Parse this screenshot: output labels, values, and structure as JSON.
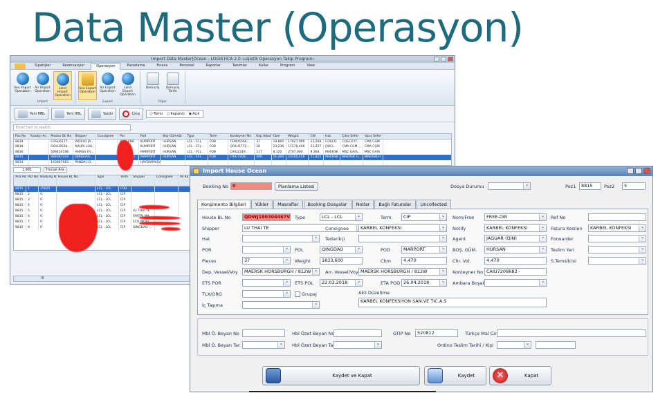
{
  "slide": {
    "title": "Data Master (Operasyon)"
  },
  "back_window": {
    "title": "Import Data Master|Ocean - LOGISTICA 2.0 -Lojistik Operasyon Takip Programı",
    "tabs": [
      "Siparişler",
      "Rezervasyon",
      "Operasyon",
      "Pazarlama",
      "Finans",
      "Personel",
      "Raporlar",
      "Tanımlar",
      "Kullar",
      "Program",
      "View"
    ],
    "active_tab": "Operasyon",
    "ribbon_import": {
      "label": "Import",
      "buttons": [
        "Sea Import Operation",
        "Air Import Operation",
        "Land Import Operation"
      ]
    },
    "ribbon_export": {
      "label": "Export",
      "buttons": [
        "Sea Export Operation",
        "Air Export Operation",
        "Land Export Operation"
      ]
    },
    "ribbon_other": {
      "label": "Diğer",
      "buttons": [
        "Demuraj",
        "Demuraj Tarife"
      ]
    },
    "toolbar": {
      "new_mbl": "Yeni MBL",
      "new_hbl": "Yeni HBL",
      "print": "Yazdır",
      "exit": "Çıkış",
      "radios": [
        "Tümü",
        "Kapandı",
        "Açık"
      ]
    },
    "search_placeholder": "Enter text to search...",
    "grid1_headers": [
      "Poz No",
      "Yurtdışı Ac...",
      "Master BL No",
      "Shipper",
      "Consignee",
      "Pol",
      "Pod",
      "Boş Gümrük",
      "Type",
      "Term",
      "Konteyner No",
      "Kap Adedi",
      "Cbm",
      "Weight",
      "CW",
      "Hat",
      "Çıkış Sefer",
      "Varış Sefer"
    ],
    "grid1_rows": [
      [
        "8819",
        "",
        "COSU6177...",
        "WORLD JA...",
        "",
        "XINGANG",
        "KUMPORT",
        "HURSAN",
        "LCL - FCL",
        "FOB",
        "TEMU5566...",
        "37",
        "19,865",
        "17827,000",
        "23,568",
        "COSCO",
        "COSCO IT...",
        "CMA CGM"
      ],
      [
        "8818",
        "",
        "OOLU2630...",
        "NAURI LOG...",
        "",
        "DUSAN",
        "KUMPORT",
        "HURSAN",
        "LCL - FCL",
        "FOB",
        "OOLU1772...",
        "38",
        "23,239",
        "11578,400",
        "23,427",
        "OOCL",
        "CMA CGM ...",
        "CMA CGM"
      ],
      [
        "8816",
        "",
        "599454198",
        "AMASS FR...",
        "",
        "NINGBO",
        "MARPORT",
        "HURSAN",
        "LCL - FCL",
        "FOB",
        "CAIU2319...",
        "117",
        "8,120",
        "2707,000",
        "9,368",
        "MAERSK",
        "MSC GAIA...",
        "MSC GAIA"
      ],
      [
        "8815",
        "",
        "984087243",
        "QINGDAO...",
        "",
        "QINGDAO",
        "MARPORT",
        "HURSAN",
        "LCL - FCL",
        "FOB",
        "CAIU7208...",
        "400",
        "51,400",
        "23550,450",
        "51,815",
        "MAERSK",
        "MAERSK H...",
        "MAERSK H"
      ],
      [
        "8814",
        "",
        "143867983...",
        "PANDA LO...",
        "",
        "NINGBO",
        "HAYDARPAŞA",
        "",
        "",
        "",
        "",
        "",
        "",
        "",
        "",
        "",
        "",
        ""
      ]
    ],
    "grid1_count": "1.981",
    "house_btn": "House Ara",
    "grid2_headers": [
      "Ana Poz",
      "Poz No",
      "Booking No",
      "House BL No",
      "Type",
      "Term",
      "Shipper",
      "Consignee",
      "Pa Ka"
    ],
    "grid2_rows": [
      [
        "8815",
        "1",
        "15825",
        "",
        "LCL - LCL",
        "FOB",
        "",
        "",
        ""
      ],
      [
        "8815",
        "2",
        "0",
        "",
        "LCL - LCL",
        "CIP",
        "",
        "",
        ""
      ],
      [
        "8815",
        "3",
        "0",
        "",
        "LCL - LCL",
        "CIP",
        "",
        "",
        ""
      ],
      [
        "8815",
        "4",
        "0",
        "",
        "LCL - LCL",
        "CIP",
        "",
        "",
        ""
      ],
      [
        "8815",
        "5",
        "0",
        "",
        "LCL - LCL",
        "CIP",
        "LU THAI TE",
        "",
        ""
      ],
      [
        "8815",
        "6",
        "0",
        "",
        "LCL - LCL",
        "CIP",
        "FANTAI MA...",
        "",
        ""
      ],
      [
        "8815",
        "7",
        "0",
        "",
        "LCL - LCL",
        "CIP",
        "ECU WORL...",
        "",
        ""
      ],
      [
        "8815",
        "8",
        "0",
        "",
        "LCL - LCL",
        "CIP",
        "QINGDAO ...",
        "",
        ""
      ]
    ],
    "grid2_footer": "8"
  },
  "dialog": {
    "title": "Import House Ocean",
    "booking_no_label": "Booking No",
    "booking_no_value": "0",
    "planlama_btn": "Planlama Listesi",
    "dosya_durumu_label": "Dosya Durumu",
    "poz1_label": "Poz1",
    "poz1_value": "8815",
    "poz2_label": "Poz2",
    "poz2_value": "5",
    "tabs": [
      "Konşimento Bilgileri",
      "Yükler",
      "Masraflar",
      "Booking Dosyalar",
      "Notlar",
      "Bağlı Faturalar",
      "Uncollected"
    ],
    "active_tab": "Konşimento Bilgileri",
    "fields": {
      "house_bl_no_label": "House BL No",
      "house_bl_no": "QDWJ180304467V",
      "type_label": "Type",
      "type": "LCL - LCL",
      "term_label": "Term",
      "term": "CIP",
      "nomfree_label": "Nom/Free",
      "nomfree": "FREE-DIR",
      "refno_label": "Ref No",
      "shipper_label": "Shipper",
      "shipper": "LU THAI TE",
      "consignee_label": "Consignee",
      "consignee": "KARBEL KONFEKSI",
      "notify_label": "Notify",
      "notify": "KARBEL KONFEKSI",
      "fatura_label": "Fatura Kesilen",
      "fatura": "KARBEL KONFEKSI",
      "hat_label": "Hat",
      "tedarikci_label": "Tedarikçi",
      "agent_label": "Agent",
      "agent": "JAGUAR (QIN)",
      "forwarder_label": "Forwarder",
      "por_label": "POR",
      "pol_label": "POL",
      "pol": "QINGDAO",
      "pod_label": "POD",
      "pod": "MARPORT",
      "bos_gum_label": "BOŞ. GÜM.",
      "bos_gum": "HURSAN",
      "teslim_label": "Teslim Yeri",
      "pieces_label": "Pieces",
      "pieces": "37",
      "weight_label": "Weight",
      "weight": "1833,600",
      "cbm_label": "Cbm",
      "cbm": "4,470",
      "chr_label": "Chr. Vol.",
      "chr": "4,470",
      "temsilci_label": "S.Temsilcisi",
      "dep_vessel_label": "Dep. Vessel/Voy",
      "dep_vessel": "MAERSK HORSBURGH / 812W",
      "arr_vessel_label": "Arr. Vessel/Voy",
      "arr_vessel": "MAERSK HORSBURGH / 812W",
      "konteyner_label": "Konteyner No",
      "konteyner": "CAIU7208683 -",
      "ets_por_label": "ETS POR",
      "ets_pol_label": "ETS POL",
      "ets_pol": "22.03.2018",
      "eta_pod_label": "ETA  POD",
      "eta_pod": "26.04.2018",
      "ambara_label": "Ambara Boşaldı",
      "tlx_label": "TLX/ORG",
      "grupaj_label": "Grupaj",
      "akli_label": "Akli Düzeltme",
      "ic_tasima_label": "İç Taşıma",
      "akli_value": "KARBEL KONFEKSIYON SAN.VE TIC.A.S"
    },
    "lower": {
      "mbl_ozet_label": "Mbl Ö. Beyan No",
      "hbl_ozet_label": "Hbl Özet Beyan No",
      "gtip_label": "GTIP No",
      "gtip": "520812",
      "turkce_label": "Türkçe Mal Cinsi",
      "mbl_tar_label": "Mbl Ö. Beyan Tar.",
      "hbl_tar_label": "Hbl Özet Beyan Tar.",
      "ordino_label": "Ordino Teslim Tarihi / Kişi"
    },
    "buttons": {
      "save_close": "Kaydet ve Kapat",
      "save": "Kaydet",
      "close": "Kapat"
    }
  }
}
